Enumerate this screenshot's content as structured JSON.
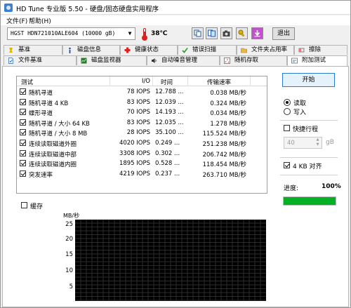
{
  "window": {
    "title": "HD Tune 专业版 5.50 - 硬盘/固态硬盘实用程序",
    "colors": {
      "accent": "#2a7ad4",
      "progress": "#06b025",
      "graph_bg": "#000000",
      "temp_red": "#d22222"
    }
  },
  "menu": {
    "items": [
      "文件(F)",
      "帮助(H)"
    ]
  },
  "toolbar": {
    "drive": "HGST HDN721010ALE604 (10000 gB)",
    "temperature": "38℃",
    "buttons": [
      "copy-icon",
      "copy-all-icon",
      "camera-icon",
      "keys-icon",
      "download-icon"
    ],
    "exit_label": "退出"
  },
  "tabs": {
    "row1": [
      {
        "label": "基准",
        "icon": "benchmark-icon"
      },
      {
        "label": "磁盘信息",
        "icon": "disk-info-icon"
      },
      {
        "label": "健康状态",
        "icon": "health-icon"
      },
      {
        "label": "错误扫描",
        "icon": "error-scan-icon"
      },
      {
        "label": "文件夹占用率",
        "icon": "folder-usage-icon"
      },
      {
        "label": "擦除",
        "icon": "erase-icon"
      }
    ],
    "row2": [
      {
        "label": "文件基准",
        "icon": "file-benchmark-icon"
      },
      {
        "label": "磁盘监视器",
        "icon": "disk-monitor-icon"
      },
      {
        "label": "自动噪音管理",
        "icon": "noise-icon"
      },
      {
        "label": "随机存取",
        "icon": "random-access-icon"
      },
      {
        "label": "附加测试",
        "icon": "extra-tests-icon"
      }
    ]
  },
  "table": {
    "headers": [
      "测试",
      "I/O",
      "时间",
      "传输速率"
    ],
    "rows": [
      {
        "test": "随机寻道",
        "io": "78 IOPS",
        "time": "12.788 ...",
        "rate": "0.038 MB/秒",
        "checked": true
      },
      {
        "test": "随机寻道 4 KB",
        "io": "83 IOPS",
        "time": "12.039 ...",
        "rate": "0.324 MB/秒",
        "checked": true
      },
      {
        "test": "蝶形寻道",
        "io": "70 IOPS",
        "time": "14.193 ...",
        "rate": "0.034 MB/秒",
        "checked": true
      },
      {
        "test": "随机寻道 / 大小 64 KB",
        "io": "83 IOPS",
        "time": "12.035 ...",
        "rate": "1.278 MB/秒",
        "checked": true
      },
      {
        "test": "随机寻道 / 大小 8 MB",
        "io": "28 IOPS",
        "time": "35.100 ...",
        "rate": "115.524 MB/秒",
        "checked": true
      },
      {
        "test": "连续读取磁道外圈",
        "io": "4020 IOPS",
        "time": "0.249 ...",
        "rate": "251.238 MB/秒",
        "checked": true
      },
      {
        "test": "连续读取磁道中部",
        "io": "3308 IOPS",
        "time": "0.302 ...",
        "rate": "206.742 MB/秒",
        "checked": true
      },
      {
        "test": "连续读取磁道内圈",
        "io": "1895 IOPS",
        "time": "0.528 ...",
        "rate": "118.454 MB/秒",
        "checked": true
      },
      {
        "test": "突发速率",
        "io": "4219 IOPS",
        "time": "0.237 ...",
        "rate": "263.710 MB/秒",
        "checked": true
      }
    ]
  },
  "controls": {
    "start_label": "开始",
    "read_label": "读取",
    "write_label": "写入",
    "mode_selected": "read",
    "quick_scan_label": "快捷行程",
    "quick_scan_checked": false,
    "quick_scan_value": "40",
    "quick_scan_unit": "gB",
    "align_label": "4 KB 对齐",
    "align_checked": true,
    "progress_label": "进度:",
    "progress_text": "100%",
    "progress_value": 1.0
  },
  "cache_label": "缓存",
  "cache_checked": false,
  "graph": {
    "y_unit": "MB/秒",
    "y_ticks": [
      "25",
      "20",
      "15",
      "10",
      "5"
    ]
  }
}
